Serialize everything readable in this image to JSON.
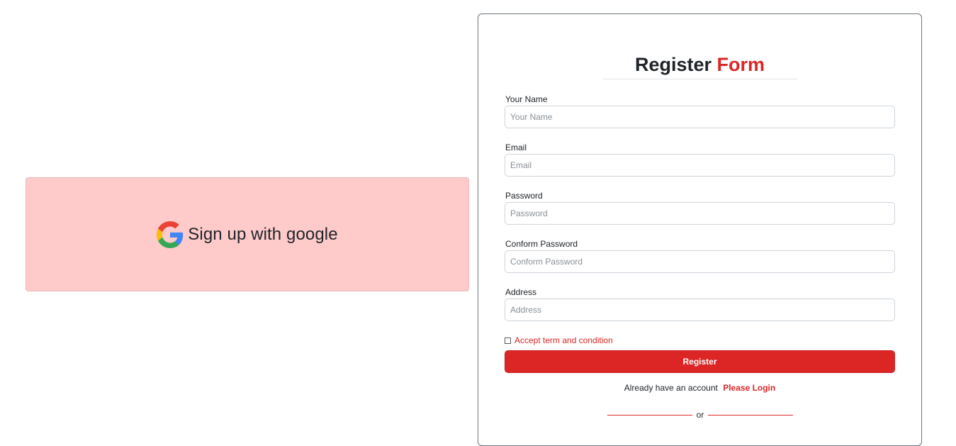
{
  "google": {
    "label": "Sign up with google",
    "icon": "google-g-icon"
  },
  "form": {
    "title_main": "Register",
    "title_accent": "Form",
    "fields": [
      {
        "label": "Your Name",
        "placeholder": "Your Name",
        "value": ""
      },
      {
        "label": "Email",
        "placeholder": "Email",
        "value": ""
      },
      {
        "label": "Password",
        "placeholder": "Password",
        "value": ""
      },
      {
        "label": "Conform Password",
        "placeholder": "Conform Password",
        "value": ""
      },
      {
        "label": "Address",
        "placeholder": "Address",
        "value": ""
      }
    ],
    "terms_label": "Accept term and condition",
    "terms_checked": false,
    "register_label": "Register",
    "login_prompt": "Already have an account",
    "login_link": "Please Login",
    "divider_text": "or"
  },
  "colors": {
    "accent": "#dc2626",
    "google_card_bg": "#fecaca",
    "text": "#212529"
  }
}
